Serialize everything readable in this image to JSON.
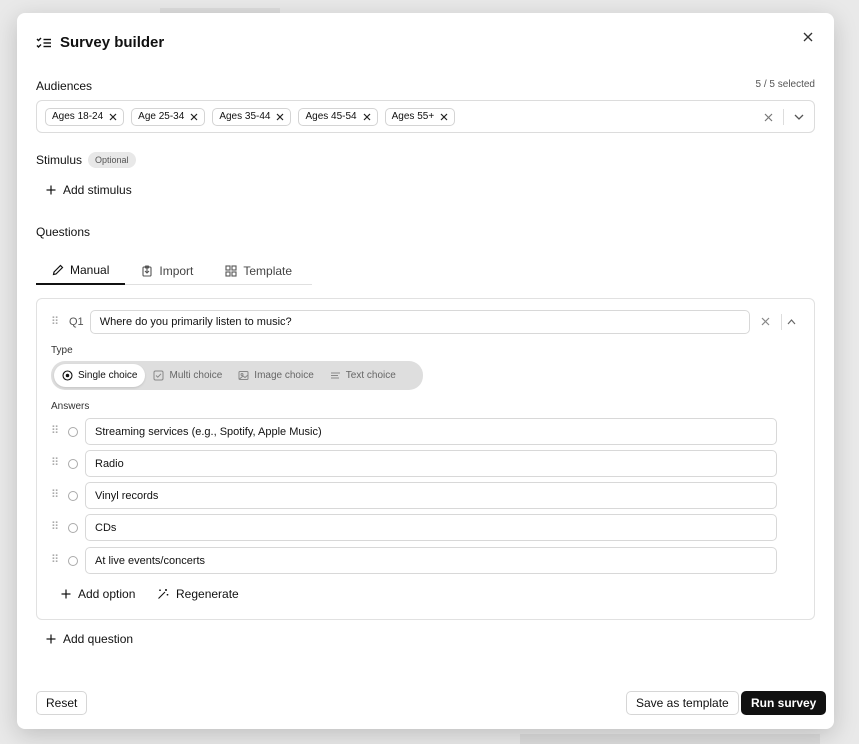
{
  "dialog": {
    "title": "Survey builder",
    "title_icon": "checklist-icon",
    "close_icon": "close-icon"
  },
  "audiences": {
    "label": "Audiences",
    "count_text": "5 / 5 selected",
    "chips": [
      "Ages 18-24",
      "Age 25-34",
      "Ages 35-44",
      "Ages 45-54",
      "Ages 55+"
    ],
    "clear_icon": "close-icon",
    "dropdown_icon": "chevron-down-icon"
  },
  "stimulus": {
    "label": "Stimulus",
    "badge": "Optional",
    "add_label": "Add stimulus"
  },
  "questions": {
    "label": "Questions",
    "tabs": [
      {
        "label": "Manual",
        "icon": "pencil-icon",
        "active": true
      },
      {
        "label": "Import",
        "icon": "import-icon",
        "active": false
      },
      {
        "label": "Template",
        "icon": "grid-icon",
        "active": false
      }
    ],
    "items": [
      {
        "number": "Q1",
        "text": "Where do you primarily listen to music?",
        "type_label": "Type",
        "types": [
          {
            "label": "Single choice",
            "icon": "radio-icon",
            "selected": true
          },
          {
            "label": "Multi choice",
            "icon": "checkbox-icon",
            "selected": false
          },
          {
            "label": "Image choice",
            "icon": "image-icon",
            "selected": false
          },
          {
            "label": "Text choice",
            "icon": "text-lines-icon",
            "selected": false
          }
        ],
        "answers_label": "Answers",
        "answers": [
          "Streaming services (e.g., Spotify, Apple Music)",
          "Radio",
          "Vinyl records",
          "CDs",
          "At live events/concerts"
        ],
        "add_option_label": "Add option",
        "regenerate_label": "Regenerate"
      }
    ],
    "add_question_label": "Add question"
  },
  "footer": {
    "reset_label": "Reset",
    "save_template_label": "Save as template",
    "run_label": "Run survey"
  },
  "colors": {
    "primary": "#111111",
    "border": "#dcdcdc",
    "muted_bg": "#dedede"
  }
}
